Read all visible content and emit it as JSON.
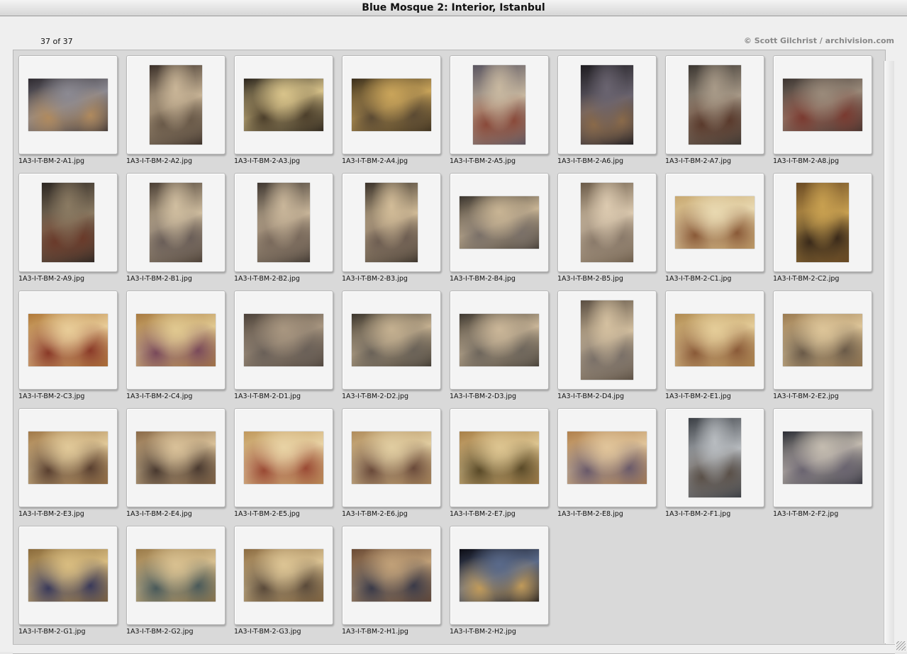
{
  "window": {
    "title": "Blue Mosque 2: Interior, Istanbul",
    "counter": "37 of 37",
    "credit": "© Scott Gilchrist / archivision.com"
  },
  "thumbnails": [
    {
      "filename": "1A3-I-T-BM-2-A1.jpg",
      "orientation": "landscape",
      "colors": [
        "#2e2a30",
        "#8c8a92",
        "#b08a5e"
      ]
    },
    {
      "filename": "1A3-I-T-BM-2-A2.jpg",
      "orientation": "portrait",
      "colors": [
        "#3a2f28",
        "#c9b597",
        "#6a5a49"
      ]
    },
    {
      "filename": "1A3-I-T-BM-2-A3.jpg",
      "orientation": "landscape",
      "colors": [
        "#2a241c",
        "#d8c38a",
        "#4c3f2b"
      ]
    },
    {
      "filename": "1A3-I-T-BM-2-A4.jpg",
      "orientation": "landscape",
      "colors": [
        "#3a2e1c",
        "#c9a45a",
        "#5b4a33"
      ]
    },
    {
      "filename": "1A3-I-T-BM-2-A5.jpg",
      "orientation": "portrait",
      "colors": [
        "#5a5560",
        "#c8b8a0",
        "#8a4a3a"
      ]
    },
    {
      "filename": "1A3-I-T-BM-2-A6.jpg",
      "orientation": "portrait",
      "colors": [
        "#1e1c20",
        "#6a6470",
        "#8a6a4a"
      ]
    },
    {
      "filename": "1A3-I-T-BM-2-A7.jpg",
      "orientation": "portrait",
      "colors": [
        "#3a3530",
        "#a89a88",
        "#5a3a2c"
      ]
    },
    {
      "filename": "1A3-I-T-BM-2-A8.jpg",
      "orientation": "landscape",
      "colors": [
        "#3c3430",
        "#9a8a7a",
        "#7a3a30"
      ]
    },
    {
      "filename": "1A3-I-T-BM-2-A9.jpg",
      "orientation": "portrait",
      "colors": [
        "#2c2622",
        "#8a7a62",
        "#6a3a2a"
      ]
    },
    {
      "filename": "1A3-I-T-BM-2-B1.jpg",
      "orientation": "portrait",
      "colors": [
        "#4a3e34",
        "#d0bea0",
        "#6a5e58"
      ]
    },
    {
      "filename": "1A3-I-T-BM-2-B2.jpg",
      "orientation": "portrait",
      "colors": [
        "#3e3630",
        "#c9b69a",
        "#7a6a5c"
      ]
    },
    {
      "filename": "1A3-I-T-BM-2-B3.jpg",
      "orientation": "portrait",
      "colors": [
        "#3a322a",
        "#d2bc98",
        "#6e5e52"
      ]
    },
    {
      "filename": "1A3-I-T-BM-2-B4.jpg",
      "orientation": "landscape",
      "colors": [
        "#3a342e",
        "#c8b494",
        "#7a7068"
      ]
    },
    {
      "filename": "1A3-I-T-BM-2-B5.jpg",
      "orientation": "portrait",
      "colors": [
        "#6a5a48",
        "#dccab0",
        "#8a7a6a"
      ]
    },
    {
      "filename": "1A3-I-T-BM-2-C1.jpg",
      "orientation": "landscape",
      "colors": [
        "#c8a870",
        "#e8d8b0",
        "#8a5a38"
      ]
    },
    {
      "filename": "1A3-I-T-BM-2-C2.jpg",
      "orientation": "portrait",
      "colors": [
        "#6a4a24",
        "#c8a050",
        "#3a2a1a"
      ]
    },
    {
      "filename": "1A3-I-T-BM-2-C3.jpg",
      "orientation": "landscape",
      "colors": [
        "#b07838",
        "#e8cc98",
        "#8a3a28"
      ]
    },
    {
      "filename": "1A3-I-T-BM-2-C4.jpg",
      "orientation": "landscape",
      "colors": [
        "#a87a40",
        "#e0c890",
        "#7a4a5a"
      ]
    },
    {
      "filename": "1A3-I-T-BM-2-D1.jpg",
      "orientation": "landscape",
      "colors": [
        "#4a4038",
        "#a89680",
        "#6a6058"
      ]
    },
    {
      "filename": "1A3-I-T-BM-2-D2.jpg",
      "orientation": "landscape",
      "colors": [
        "#3a342c",
        "#c4b090",
        "#6a6258"
      ]
    },
    {
      "filename": "1A3-I-T-BM-2-D3.jpg",
      "orientation": "landscape",
      "colors": [
        "#3e3830",
        "#cab698",
        "#6e665c"
      ]
    },
    {
      "filename": "1A3-I-T-BM-2-D4.jpg",
      "orientation": "portrait",
      "colors": [
        "#5a4e42",
        "#d4c0a0",
        "#7a7068"
      ]
    },
    {
      "filename": "1A3-I-T-BM-2-E1.jpg",
      "orientation": "landscape",
      "colors": [
        "#b08a50",
        "#e4cc98",
        "#8a5a38"
      ]
    },
    {
      "filename": "1A3-I-T-BM-2-E2.jpg",
      "orientation": "landscape",
      "colors": [
        "#9a7a50",
        "#dcc498",
        "#6a5a48"
      ]
    },
    {
      "filename": "1A3-I-T-BM-2-E3.jpg",
      "orientation": "landscape",
      "colors": [
        "#a07848",
        "#e0c898",
        "#5a4030"
      ]
    },
    {
      "filename": "1A3-I-T-BM-2-E4.jpg",
      "orientation": "landscape",
      "colors": [
        "#8a6a48",
        "#d8c098",
        "#4a3a30"
      ]
    },
    {
      "filename": "1A3-I-T-BM-2-E5.jpg",
      "orientation": "landscape",
      "colors": [
        "#c0985c",
        "#e8d2a4",
        "#9a4a34"
      ]
    },
    {
      "filename": "1A3-I-T-BM-2-E6.jpg",
      "orientation": "landscape",
      "colors": [
        "#b08c5c",
        "#e0cca0",
        "#6a4a3a"
      ]
    },
    {
      "filename": "1A3-I-T-BM-2-E7.jpg",
      "orientation": "landscape",
      "colors": [
        "#a88048",
        "#dcc490",
        "#5a4a28"
      ]
    },
    {
      "filename": "1A3-I-T-BM-2-E8.jpg",
      "orientation": "landscape",
      "colors": [
        "#b0804c",
        "#e0c49a",
        "#6a5a6a"
      ]
    },
    {
      "filename": "1A3-I-T-BM-2-F1.jpg",
      "orientation": "portrait",
      "colors": [
        "#3a3e44",
        "#b8bcc0",
        "#5a5048"
      ]
    },
    {
      "filename": "1A3-I-T-BM-2-F2.jpg",
      "orientation": "landscape",
      "colors": [
        "#2a2c34",
        "#c4bcb0",
        "#6a6470"
      ]
    },
    {
      "filename": "1A3-I-T-BM-2-G1.jpg",
      "orientation": "landscape",
      "colors": [
        "#8a6a3a",
        "#d8bc80",
        "#3a3a5a"
      ]
    },
    {
      "filename": "1A3-I-T-BM-2-G2.jpg",
      "orientation": "landscape",
      "colors": [
        "#9a7a48",
        "#d8c090",
        "#4a5a5a"
      ]
    },
    {
      "filename": "1A3-I-T-BM-2-G3.jpg",
      "orientation": "landscape",
      "colors": [
        "#8a6a40",
        "#dcc494",
        "#5a4a3a"
      ]
    },
    {
      "filename": "1A3-I-T-BM-2-H1.jpg",
      "orientation": "landscape",
      "colors": [
        "#6a4a34",
        "#c0a078",
        "#3a3a48"
      ]
    },
    {
      "filename": "1A3-I-T-BM-2-H2.jpg",
      "orientation": "landscape",
      "colors": [
        "#0c0c14",
        "#5a6a8a",
        "#c09a5a"
      ]
    }
  ]
}
